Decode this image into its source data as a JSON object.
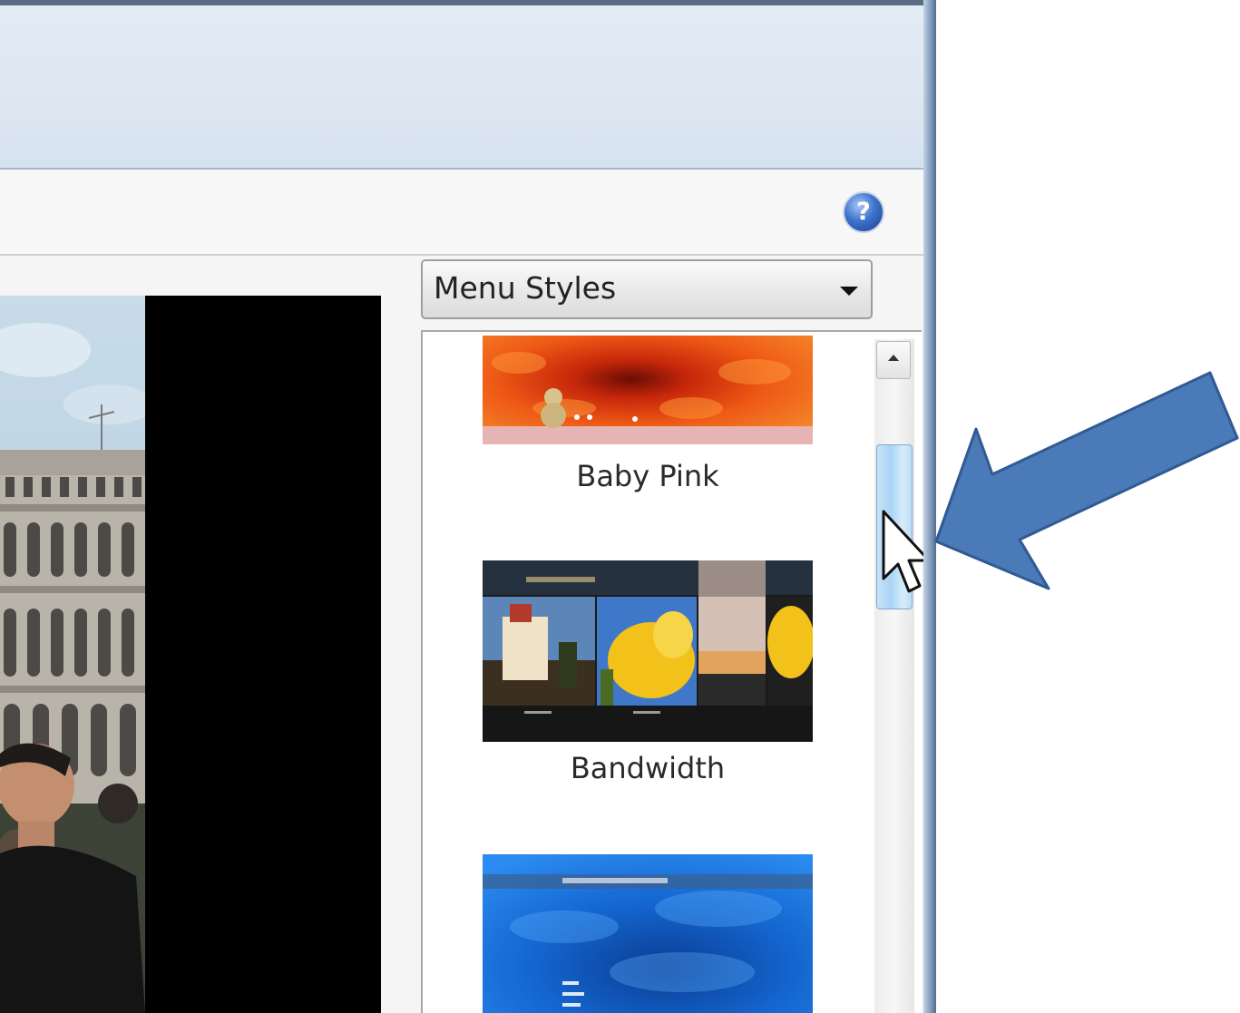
{
  "toolbar": {
    "help_glyph": "?"
  },
  "style_selector": {
    "selected": "Menu Styles"
  },
  "menu_styles": [
    {
      "label": "Baby Pink",
      "accent": "#e33a12"
    },
    {
      "label": "Bandwidth",
      "accent": "#f2c21a"
    },
    {
      "label": "",
      "accent": "#1a6fd6"
    }
  ],
  "colors": {
    "annotation_arrow": "#4a7ab8",
    "scroll_thumb": "#a8d3f3",
    "titlebar": "#dde7f2"
  }
}
